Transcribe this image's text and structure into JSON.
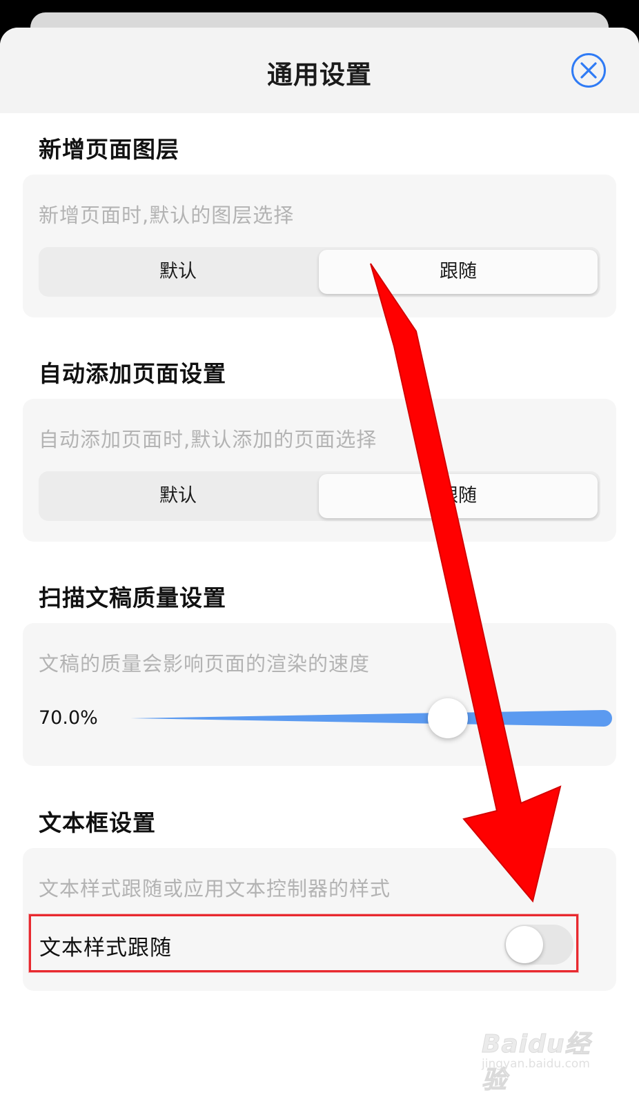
{
  "header": {
    "title": "通用设置",
    "close_icon": "close-circle-icon"
  },
  "sections": [
    {
      "title": "新增页面图层",
      "description": "新增页面时,默认的图层选择",
      "options": [
        "默认",
        "跟随"
      ],
      "selected": "跟随"
    },
    {
      "title": "自动添加页面设置",
      "description": "自动添加页面时,默认添加的页面选择",
      "options": [
        "默认",
        "跟随"
      ],
      "selected": "跟随"
    },
    {
      "title": "扫描文稿质量设置",
      "description": "文稿的质量会影响页面的渲染的速度",
      "slider": {
        "value_label": "70.0%",
        "fraction": 0.7
      }
    },
    {
      "title": "文本框设置",
      "description": "文本样式跟随或应用文本控制器的样式",
      "toggle": {
        "label": "文本样式跟随",
        "on": false
      }
    }
  ],
  "colors": {
    "accent": "#2f7bf5",
    "slider_fill": "#5b9af0",
    "highlight_box": "#e8292f",
    "annotation_arrow": "#ff0000"
  },
  "watermark": {
    "brand": "Baidu经验",
    "url": "jingyan.baidu.com"
  }
}
